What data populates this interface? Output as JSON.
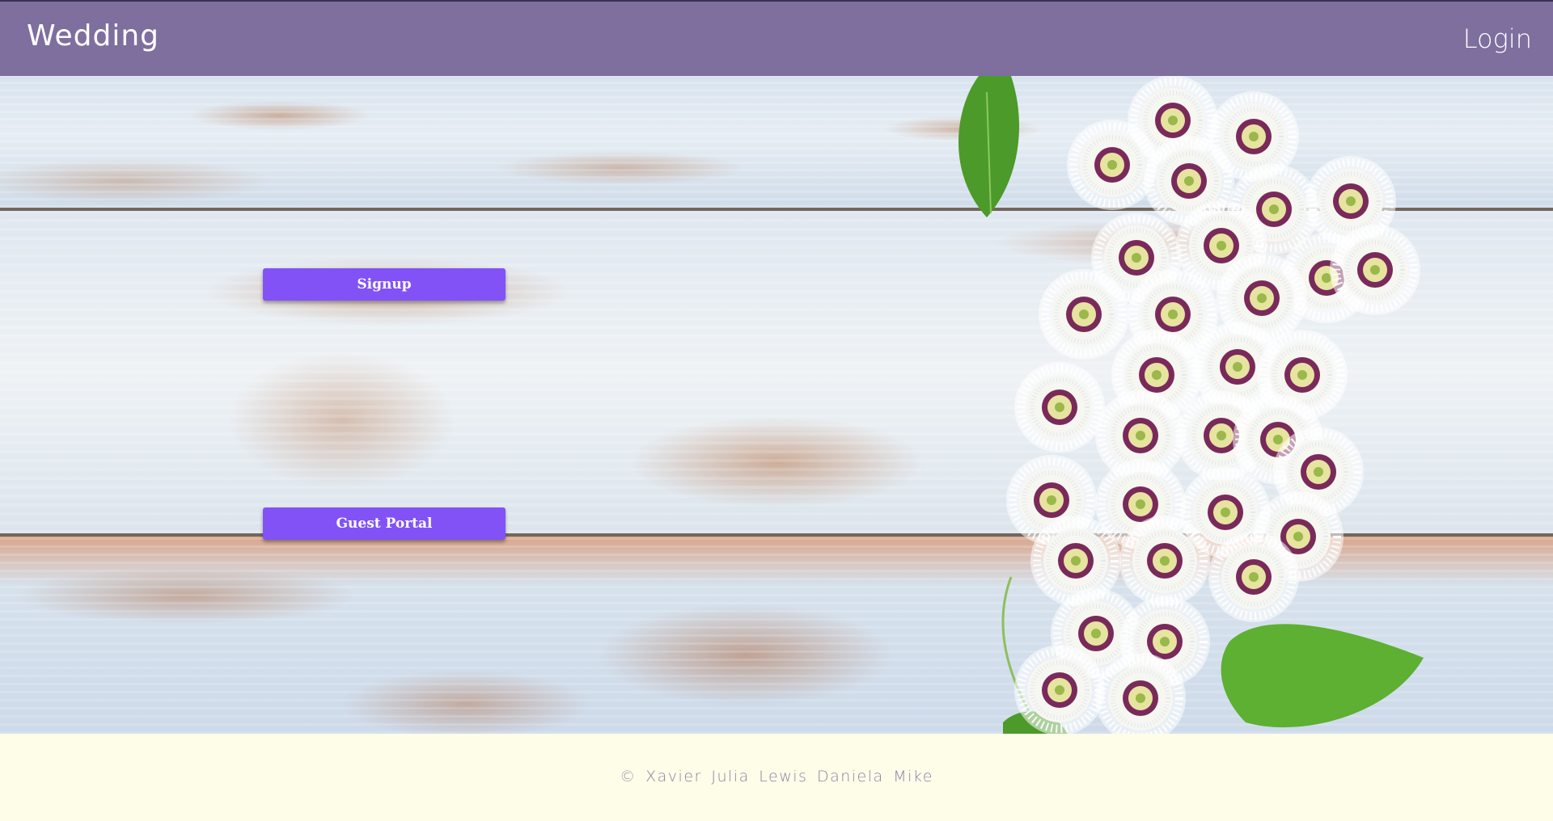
{
  "header": {
    "brand": "Wedding",
    "login_label": "Login",
    "background_color": "#7e6f9f"
  },
  "hero": {
    "signup_label": "Signup",
    "guest_portal_label": "Guest Portal",
    "button_color": "#8252f7"
  },
  "footer": {
    "copyright": "© Xavier Julia Lewis Daniela Mike",
    "text_color": "#8c7fa8",
    "background_color": "#fefde8"
  }
}
